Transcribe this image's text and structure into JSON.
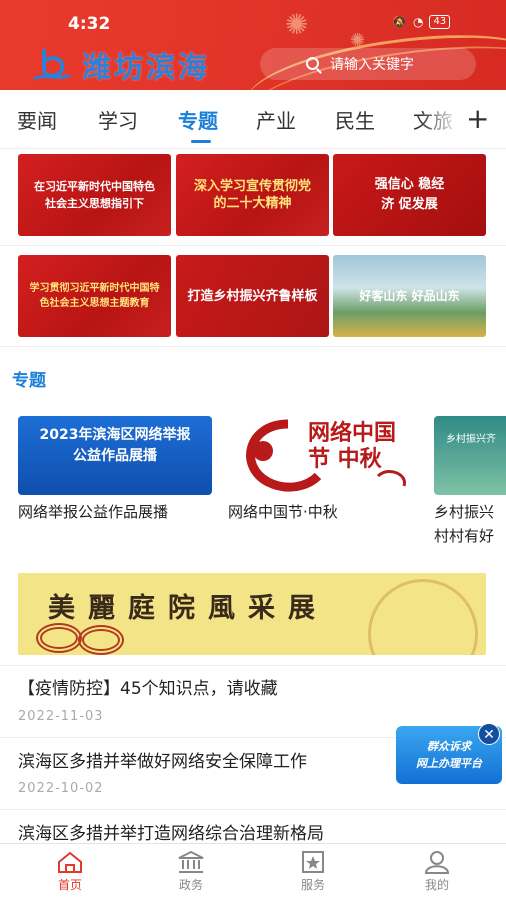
{
  "status": {
    "time": "4:32",
    "battery": "43"
  },
  "header": {
    "logo_text": "潍坊滨海",
    "search_placeholder": "请输入关键字"
  },
  "tabs": [
    {
      "label": "要闻",
      "active": false
    },
    {
      "label": "学习",
      "active": false
    },
    {
      "label": "专题",
      "active": true
    },
    {
      "label": "产业",
      "active": false
    },
    {
      "label": "民生",
      "active": false
    },
    {
      "label": "文旅",
      "active": false
    }
  ],
  "banners": [
    {
      "text": "在习近平新时代中国特色社会主义思想指引下"
    },
    {
      "text": "深入学习宣传贯彻党的二十大精神"
    },
    {
      "text": "强信心 稳经济 促发展"
    },
    {
      "text": "学习贯彻习近平新时代中国特色社会主义思想主题教育"
    },
    {
      "text": "打造乡村振兴齐鲁样板"
    },
    {
      "text": "好客山东 好品山东"
    }
  ],
  "section": {
    "title": "专题"
  },
  "special_cards": [
    {
      "image_text": "2023年滨海区网络举报公益作品展播",
      "caption": "网络举报公益作品展播"
    },
    {
      "image_text": "网络中国节 中秋",
      "caption": "网络中国节·中秋"
    },
    {
      "image_text": "乡村振兴齐",
      "caption": "乡村振兴村村有好"
    }
  ],
  "long_banner": {
    "text": "美麗庭院風采展"
  },
  "news": [
    {
      "title": "【疫情防控】45个知识点，请收藏",
      "date": "2022-11-03"
    },
    {
      "title": "滨海区多措并举做好网络安全保障工作",
      "date": "2022-10-02"
    },
    {
      "title": "滨海区多措并举打造网络综合治理新格局",
      "date": ""
    }
  ],
  "floating": {
    "line1": "群众诉求",
    "line2": "网上办理平台",
    "close": "✕"
  },
  "bottom_nav": [
    {
      "label": "首页",
      "icon": "home-icon",
      "active": true
    },
    {
      "label": "政务",
      "icon": "government-icon",
      "active": false
    },
    {
      "label": "服务",
      "icon": "service-icon",
      "active": false
    },
    {
      "label": "我的",
      "icon": "user-icon",
      "active": false
    }
  ],
  "colors": {
    "header_red": "#e2352a",
    "accent_blue": "#1c80d8",
    "active_red": "#e03a2c"
  }
}
